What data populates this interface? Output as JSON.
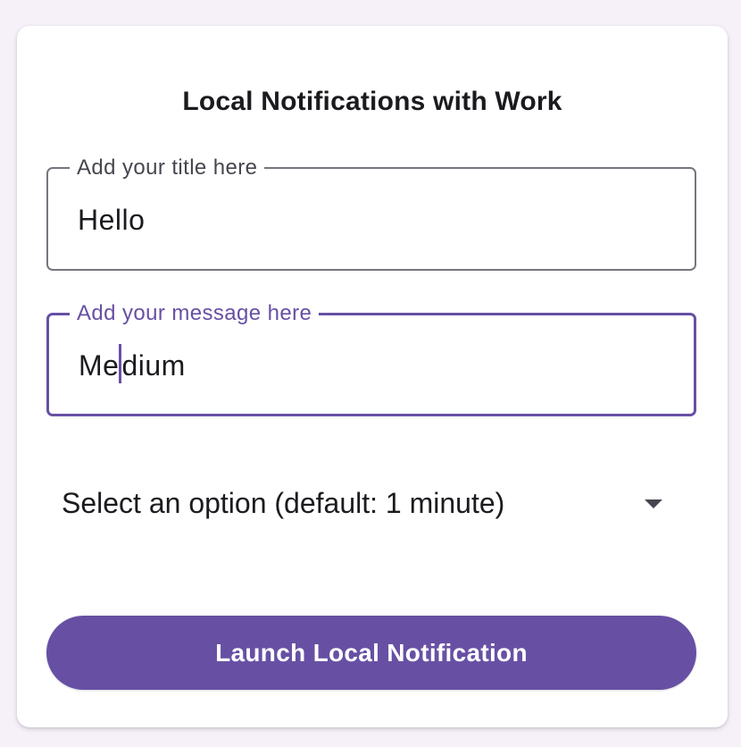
{
  "card": {
    "title": "Local Notifications with Work"
  },
  "fields": {
    "title": {
      "label": "Add your title here",
      "value": "Hello"
    },
    "message": {
      "label": "Add your message here",
      "value_before_caret": "Me",
      "value_after_caret": "dium"
    }
  },
  "dropdown": {
    "selected": "Select an option (default: 1 minute)",
    "icon": "dropdown-arrow-icon"
  },
  "button": {
    "label": "Launch Local Notification"
  },
  "colors": {
    "accent": "#6750a4",
    "outline": "#79747e",
    "background": "#f6f1f8",
    "surface": "#ffffff"
  }
}
